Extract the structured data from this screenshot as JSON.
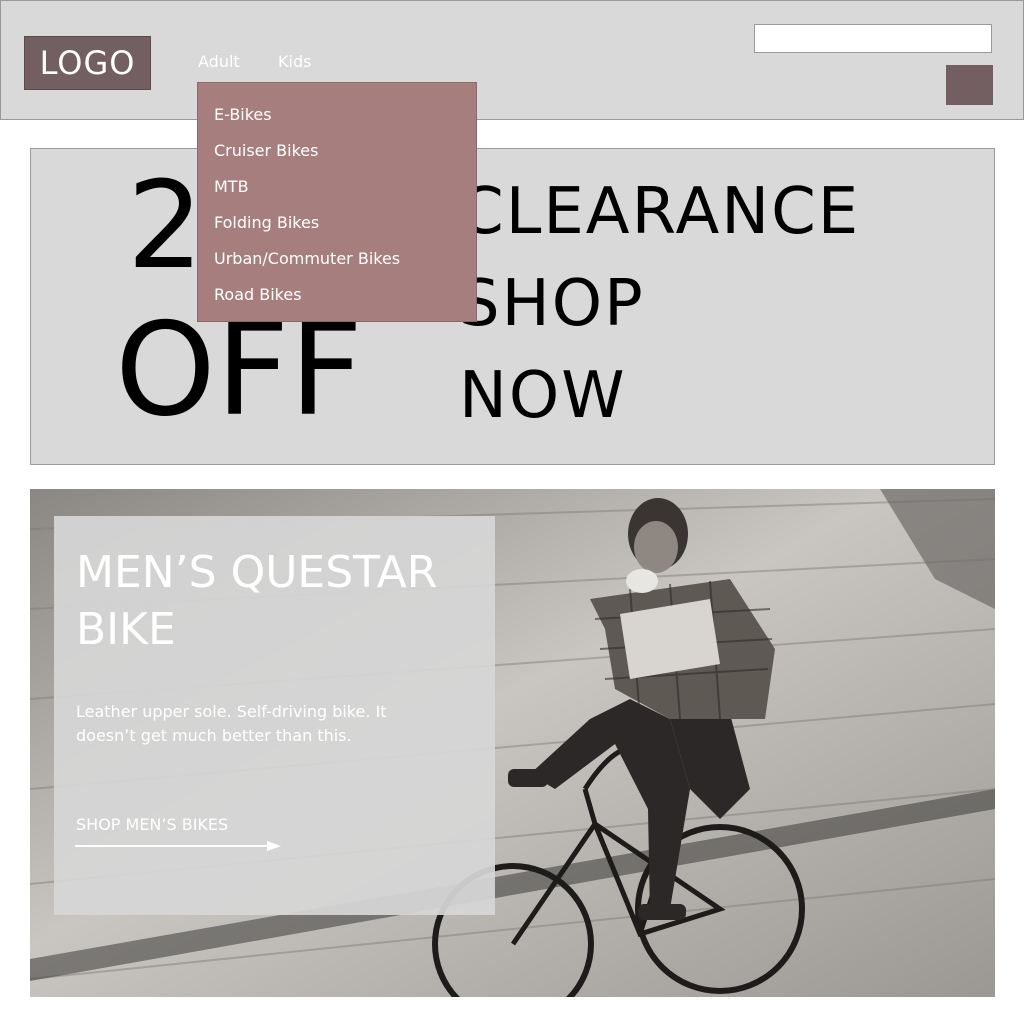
{
  "header": {
    "logo": "LOGO",
    "nav": {
      "adult": "Adult",
      "kids": "Kids"
    },
    "search": {
      "value": "",
      "placeholder": ""
    }
  },
  "dropdown": {
    "items": [
      "E-Bikes",
      "Cruiser Bikes",
      "MTB",
      "Folding Bikes",
      "Urban/Commuter Bikes",
      "Road Bikes"
    ]
  },
  "banner": {
    "promo_line1": "25%",
    "promo_line2": "OFF",
    "clearance_lines": [
      "CLEARANCE",
      "SHOP",
      "NOW"
    ]
  },
  "hero": {
    "title": "MEN’S QUESTAR BIKE",
    "description": "Leather upper sole. Self-driving bike. It doesn’t get much better than this.",
    "cta": "SHOP MEN’S BIKES"
  },
  "colors": {
    "header_bg": "#d9d9d9",
    "accent_dark": "#735f61",
    "dropdown_bg": "#a77e7e",
    "banner_bg": "#d9d9d9"
  },
  "icons": {
    "search_button": "search-button-icon",
    "cta_arrow": "arrow-right-icon"
  }
}
